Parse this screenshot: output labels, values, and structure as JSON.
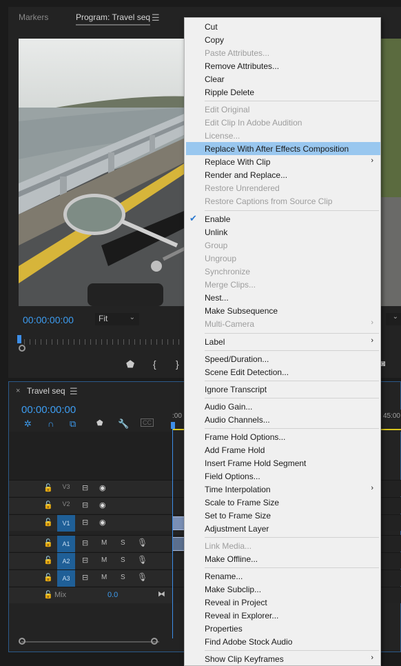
{
  "program_monitor": {
    "tab_markers": "Markers",
    "tab_program": "Program: Travel seq",
    "timecode": "00:00:00:00",
    "fit": "Fit"
  },
  "timeline": {
    "tab_name": "Travel seq",
    "timecode": "00:00:00:00",
    "ruler_start": ":00",
    "ruler_end": "45:00",
    "tracks": {
      "v3": "V3",
      "v2": "V2",
      "v1": "V1",
      "a1": "A1",
      "a2": "A2",
      "a3": "A3",
      "mute": "M",
      "solo": "S",
      "mix": "Mix",
      "mix_value": "0.0"
    }
  },
  "context_menu": {
    "cut": "Cut",
    "copy": "Copy",
    "paste_attributes": "Paste Attributes...",
    "remove_attributes": "Remove Attributes...",
    "clear": "Clear",
    "ripple_delete": "Ripple Delete",
    "edit_original": "Edit Original",
    "edit_in_audition": "Edit Clip In Adobe Audition",
    "license": "License...",
    "replace_ae": "Replace With After Effects Composition",
    "replace_clip": "Replace With Clip",
    "render_replace": "Render and Replace...",
    "restore_unrendered": "Restore Unrendered",
    "restore_captions": "Restore Captions from Source Clip",
    "enable": "Enable",
    "unlink": "Unlink",
    "group": "Group",
    "ungroup": "Ungroup",
    "synchronize": "Synchronize",
    "merge_clips": "Merge Clips...",
    "nest": "Nest...",
    "make_subsequence": "Make Subsequence",
    "multi_camera": "Multi-Camera",
    "label": "Label",
    "speed_duration": "Speed/Duration...",
    "scene_edit": "Scene Edit Detection...",
    "ignore_transcript": "Ignore Transcript",
    "audio_gain": "Audio Gain...",
    "audio_channels": "Audio Channels...",
    "frame_hold_options": "Frame Hold Options...",
    "add_frame_hold": "Add Frame Hold",
    "insert_frame_hold": "Insert Frame Hold Segment",
    "field_options": "Field Options...",
    "time_interpolation": "Time Interpolation",
    "scale_frame": "Scale to Frame Size",
    "set_frame": "Set to Frame Size",
    "adjustment_layer": "Adjustment Layer",
    "link_media": "Link Media...",
    "make_offline": "Make Offline...",
    "rename": "Rename...",
    "make_subclip": "Make Subclip...",
    "reveal_project": "Reveal in Project",
    "reveal_explorer": "Reveal in Explorer...",
    "properties": "Properties",
    "find_stock_audio": "Find Adobe Stock Audio",
    "show_keyframes": "Show Clip Keyframes"
  },
  "colors": {
    "accent_blue": "#3d9cf0",
    "menu_highlight": "#99c7ef",
    "track_target": "#1f5f97",
    "work_area": "#d8c51e"
  }
}
